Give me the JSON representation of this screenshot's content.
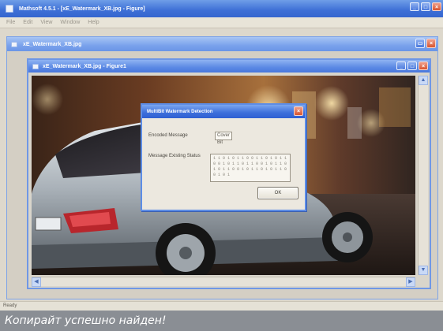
{
  "app": {
    "title": "Mathsoft 4.5.1 - [xE_Watermark_XB.jpg - Figure]",
    "menu": [
      "File",
      "Edit",
      "View",
      "Window",
      "Help"
    ],
    "status": "Ready"
  },
  "document_window": {
    "title": "xE_Watermark_XB.jpg"
  },
  "figure_window": {
    "title": "xE_Watermark_XB.jpg - Figure1"
  },
  "dialog": {
    "title": "MultiBit Watermark Detection",
    "fields": [
      {
        "label": "Encoded Message",
        "value": "Cover Bit"
      },
      {
        "label": "Message Existing Status",
        "value": "1 1 0 1 0 1 1 0 0 1 1 0 1 0 1 1 0 0 1 0 1 1 0 1 1 0 0 1 0 1 1 0 1 0 1 1 0 0 1 0 1 1 0 1 0 1 1 0 0 1 0 1"
      }
    ],
    "ok_label": "OK",
    "close_glyph": "×"
  },
  "caption": "Копирайт успешно найден!",
  "colors": {
    "title_blue": "#3f6fd8",
    "close_red": "#d8542f",
    "caption_bg": "#8a8e94"
  }
}
